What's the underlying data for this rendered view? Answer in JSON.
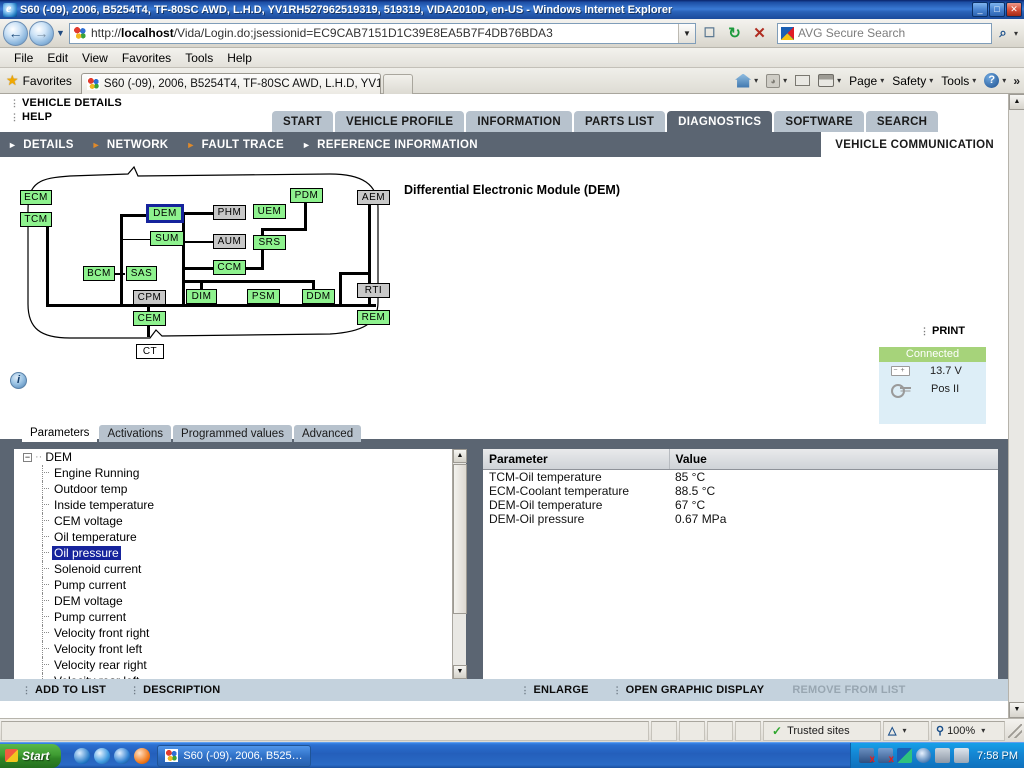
{
  "window": {
    "title": "S60 (-09), 2006, B5254T4, TF-80SC AWD, L.H.D, YV1RH527962519319, 519319, VIDA2010D, en-US - Windows Internet Explorer",
    "minimize": "_",
    "maximize": "□",
    "close": "✕"
  },
  "browser": {
    "back": "←",
    "forward": "→",
    "history_caret": "▼",
    "url_protocol": "http://",
    "url_host": "localhost",
    "url_path": "/Vida/Login.do;jsessionid=EC9CAB7151D1C39E8EA5B7F4DB76BDA3",
    "url_full": "http://localhost/Vida/Login.do;jsessionid=EC9CAB7151D1C39E8EA5B7F4DB76BDA3",
    "url_dropdown": "▼",
    "compat_title": "Compatibility View",
    "refresh": "↻",
    "stop": "✕",
    "search_placeholder": "AVG Secure Search",
    "search_go": "⌕",
    "search_caret": "▾",
    "menus": [
      "File",
      "Edit",
      "View",
      "Favorites",
      "Tools",
      "Help"
    ],
    "favorites_label": "Favorites",
    "tab_title": "S60 (-09), 2006, B5254T4, TF-80SC AWD, L.H.D, YV1…",
    "commands": [
      {
        "label": "",
        "icon": "home-icon",
        "caret": "▾"
      },
      {
        "label": "",
        "icon": "feeds-icon",
        "caret": "▾"
      },
      {
        "label": "",
        "icon": "mail-icon",
        "caret": ""
      },
      {
        "label": "",
        "icon": "print-icon",
        "caret": "▾"
      },
      {
        "label": "Page",
        "icon": "",
        "caret": "▾"
      },
      {
        "label": "Safety",
        "icon": "",
        "caret": "▾"
      },
      {
        "label": "Tools",
        "icon": "",
        "caret": "▾"
      },
      {
        "label": "",
        "icon": "help-icon",
        "caret": "▾"
      }
    ],
    "overflow": "»"
  },
  "vida": {
    "header_links": [
      {
        "label": "VEHICLE DETAILS"
      },
      {
        "label": "HELP"
      }
    ],
    "main_tabs": [
      {
        "label": "START",
        "active": false
      },
      {
        "label": "VEHICLE PROFILE",
        "active": false
      },
      {
        "label": "INFORMATION",
        "active": false
      },
      {
        "label": "PARTS LIST",
        "active": false
      },
      {
        "label": "DIAGNOSTICS",
        "active": true
      },
      {
        "label": "SOFTWARE",
        "active": false
      },
      {
        "label": "SEARCH",
        "active": false
      }
    ],
    "sub_tabs": [
      {
        "label": "DETAILS",
        "marker": "white",
        "active": false
      },
      {
        "label": "NETWORK",
        "marker": "orange",
        "active": false
      },
      {
        "label": "FAULT TRACE",
        "marker": "orange",
        "active": false
      },
      {
        "label": "REFERENCE INFORMATION",
        "marker": "white",
        "active": false
      },
      {
        "label": "VEHICLE COMMUNICATION",
        "marker": "none",
        "active": true
      }
    ],
    "diagram": {
      "title": "Differential Electronic Module (DEM)",
      "info_icon": "i",
      "nodes": [
        {
          "id": "ECM",
          "label": "ECM",
          "type": "green"
        },
        {
          "id": "TCM",
          "label": "TCM",
          "type": "green"
        },
        {
          "id": "DEM",
          "label": "DEM",
          "type": "selected"
        },
        {
          "id": "SUM",
          "label": "SUM",
          "type": "green"
        },
        {
          "id": "BCM",
          "label": "BCM",
          "type": "green"
        },
        {
          "id": "SAS",
          "label": "SAS",
          "type": "green"
        },
        {
          "id": "CPM",
          "label": "CPM",
          "type": "grey"
        },
        {
          "id": "CEM",
          "label": "CEM",
          "type": "green"
        },
        {
          "id": "CT",
          "label": "CT",
          "type": "white"
        },
        {
          "id": "PHM",
          "label": "PHM",
          "type": "grey"
        },
        {
          "id": "AUM",
          "label": "AUM",
          "type": "grey"
        },
        {
          "id": "CCM",
          "label": "CCM",
          "type": "green"
        },
        {
          "id": "UEM",
          "label": "UEM",
          "type": "green"
        },
        {
          "id": "PDM",
          "label": "PDM",
          "type": "green"
        },
        {
          "id": "SRS",
          "label": "SRS",
          "type": "green"
        },
        {
          "id": "DIM",
          "label": "DIM",
          "type": "green"
        },
        {
          "id": "PSM",
          "label": "PSM",
          "type": "green"
        },
        {
          "id": "DDM",
          "label": "DDM",
          "type": "green"
        },
        {
          "id": "AEM",
          "label": "AEM",
          "type": "grey"
        },
        {
          "id": "RTI",
          "label": "RTI",
          "type": "grey"
        },
        {
          "id": "REM",
          "label": "REM",
          "type": "green"
        }
      ]
    },
    "print_label": "PRINT",
    "status": {
      "connection": "Connected",
      "voltage": "13.7 V",
      "key_position": "Pos II",
      "battery_icon": "battery-icon",
      "key_icon": "key-icon"
    },
    "param_tabs": [
      {
        "label": "Parameters",
        "active": true
      },
      {
        "label": "Activations",
        "active": false
      },
      {
        "label": "Programmed values",
        "active": false
      },
      {
        "label": "Advanced",
        "active": false
      }
    ],
    "tree": {
      "root": "DEM",
      "expander": "−",
      "items": [
        {
          "label": "Engine Running",
          "selected": false
        },
        {
          "label": "Outdoor temp",
          "selected": false
        },
        {
          "label": "Inside temperature",
          "selected": false
        },
        {
          "label": "CEM voltage",
          "selected": false
        },
        {
          "label": "Oil temperature",
          "selected": false
        },
        {
          "label": "Oil pressure",
          "selected": true
        },
        {
          "label": "Solenoid current",
          "selected": false
        },
        {
          "label": "Pump current",
          "selected": false
        },
        {
          "label": "DEM voltage",
          "selected": false
        },
        {
          "label": "Pump current",
          "selected": false
        },
        {
          "label": "Velocity front right",
          "selected": false
        },
        {
          "label": "Velocity front left",
          "selected": false
        },
        {
          "label": "Velocity rear right",
          "selected": false
        },
        {
          "label": "Velocity rear left",
          "selected": false
        }
      ],
      "scroll_up": "▲",
      "scroll_down": "▼"
    },
    "table": {
      "columns": [
        "Parameter",
        "Value"
      ],
      "rows": [
        [
          "TCM-Oil temperature",
          "85 °C"
        ],
        [
          "ECM-Coolant temperature",
          "88.5 °C"
        ],
        [
          "DEM-Oil temperature",
          "67 °C"
        ],
        [
          "DEM-Oil pressure",
          "0.67 MPa"
        ]
      ]
    },
    "actions": [
      {
        "label": "ADD TO LIST",
        "disabled": false
      },
      {
        "label": "DESCRIPTION",
        "disabled": false
      },
      {
        "label": "ENLARGE",
        "disabled": false
      },
      {
        "label": "OPEN GRAPHIC DISPLAY",
        "disabled": false
      },
      {
        "label": "REMOVE FROM LIST",
        "disabled": true
      }
    ],
    "page_scroll_up": "▲",
    "page_scroll_down": "▼"
  },
  "statusbar": {
    "zone": "Trusted sites",
    "zone_check": "✓",
    "protect_caret": "▾",
    "zoom": "100%",
    "zoom_caret": "▾"
  },
  "taskbar": {
    "start": "Start",
    "task_title": "S60 (-09), 2006, B525…",
    "clock": "7:58 PM"
  },
  "colors": {
    "title_blue": "#1d4fa5",
    "vida_slate": "#5b6572",
    "vida_tab_grey": "#b7c2cd",
    "node_green": "#8ef28e",
    "node_grey": "#c8c8c8",
    "selected_blue": "#16239c",
    "connected_green": "#a6d37a",
    "status_panel_blue": "#ddeef7",
    "action_bar": "#c4d2dd"
  }
}
